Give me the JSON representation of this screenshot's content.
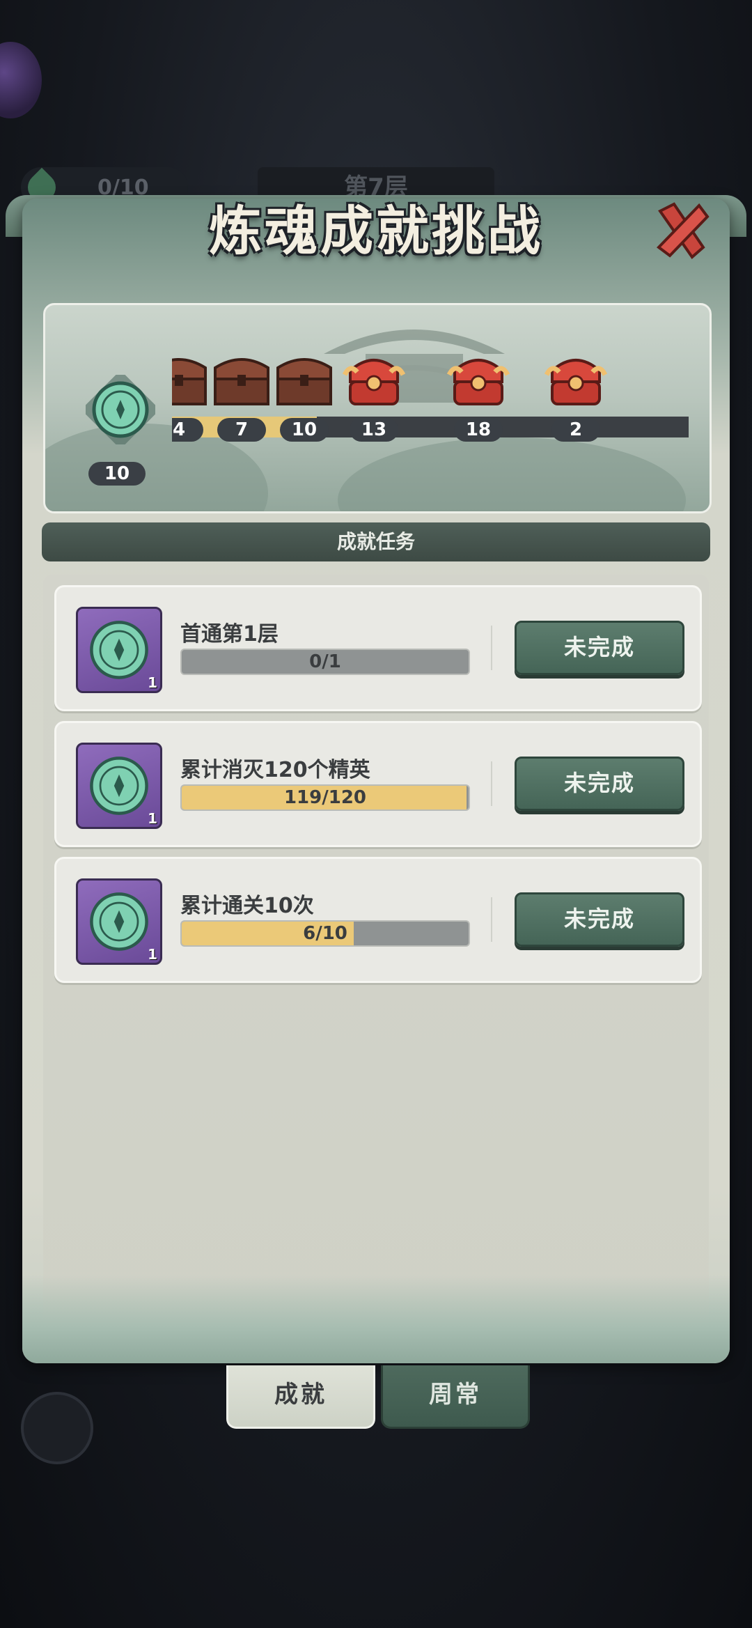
{
  "background": {
    "counter_text": "0/10",
    "floor_text": "第7层"
  },
  "header": {
    "title": "炼魂成就挑战",
    "close_icon": "close-x-icon"
  },
  "progress": {
    "start_value": "10",
    "fill_fraction": 0.28,
    "milestones": [
      {
        "value": "4",
        "chest": "wooden"
      },
      {
        "value": "7",
        "chest": "wooden"
      },
      {
        "value": "10",
        "chest": "wooden"
      },
      {
        "value": "13",
        "chest": "red-gold"
      },
      {
        "value": "18",
        "chest": "red-gold"
      },
      {
        "value": "2",
        "chest": "red-gold"
      }
    ]
  },
  "section": {
    "title": "成就任务"
  },
  "tasks": [
    {
      "name": "首通第1层",
      "progress_text": "0/1",
      "progress": 0.0,
      "reward_qty": "1",
      "status": "未完成"
    },
    {
      "name": "累计消灭120个精英",
      "progress_text": "119/120",
      "progress": 0.992,
      "reward_qty": "1",
      "status": "未完成"
    },
    {
      "name": "累计通关10次",
      "progress_text": "6/10",
      "progress": 0.6,
      "reward_qty": "1",
      "status": "未完成"
    }
  ],
  "tabs": {
    "achievement": "成就",
    "weekly": "周常",
    "active": "achievement"
  },
  "colors": {
    "progress_fill": "#ebc978",
    "button_green": "#5d7d6e",
    "reward_purple": "#8f6cbc"
  }
}
